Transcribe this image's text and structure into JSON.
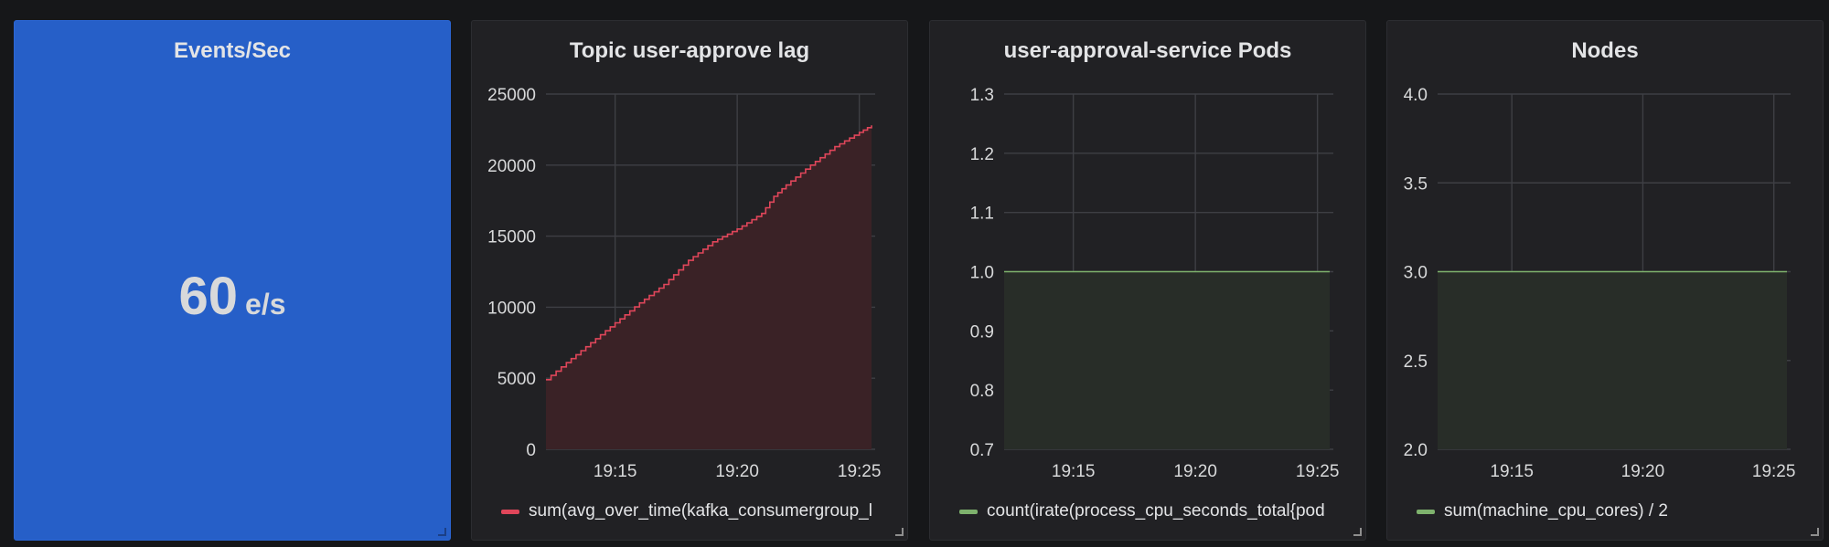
{
  "panels": {
    "events": {
      "title": "Events/Sec",
      "value": "60",
      "unit": "e/s",
      "background": "#265fc8"
    },
    "lag": {
      "title": "Topic user-approve lag"
    },
    "pods": {
      "title": "user-approval-service Pods"
    },
    "nodes": {
      "title": "Nodes"
    }
  },
  "chart_data": [
    {
      "type": "area",
      "title": "Topic user-approve lag",
      "x_ticks": [
        "19:15",
        "19:20",
        "19:25"
      ],
      "y_ticks": [
        "0",
        "5000",
        "10000",
        "15000",
        "20000",
        "25000"
      ],
      "ylim": [
        0,
        25000
      ],
      "xlim": [
        "19:12:10",
        "19:25:30"
      ],
      "grid": true,
      "series": [
        {
          "name": "sum(avg_over_time(kafka_consumergroup_l",
          "color": "#e0465a",
          "fill": "#3a2226",
          "x": [
            "19:12:10",
            "19:13:00",
            "19:14:00",
            "19:15:00",
            "19:16:00",
            "19:17:00",
            "19:18:00",
            "19:19:00",
            "19:20:00",
            "19:21:00",
            "19:21:30",
            "19:22:00",
            "19:23:00",
            "19:24:00",
            "19:25:00",
            "19:25:30"
          ],
          "values": [
            4900,
            6100,
            7500,
            8900,
            10300,
            11600,
            13300,
            14600,
            15500,
            16600,
            17800,
            18600,
            20000,
            21300,
            22300,
            22800
          ]
        }
      ]
    },
    {
      "type": "area",
      "title": "user-approval-service Pods",
      "x_ticks": [
        "19:15",
        "19:20",
        "19:25"
      ],
      "y_ticks": [
        "0.7",
        "0.8",
        "0.9",
        "1.0",
        "1.1",
        "1.2",
        "1.3"
      ],
      "ylim": [
        0.7,
        1.3
      ],
      "xlim": [
        "19:12:10",
        "19:25:30"
      ],
      "grid": true,
      "series": [
        {
          "name": "count(irate(process_cpu_seconds_total{pod",
          "color": "#7eb26d",
          "fill": "#282d28",
          "x": [
            "19:12:10",
            "19:25:30"
          ],
          "values": [
            1.0,
            1.0
          ]
        }
      ]
    },
    {
      "type": "area",
      "title": "Nodes",
      "x_ticks": [
        "19:15",
        "19:20",
        "19:25"
      ],
      "y_ticks": [
        "2.0",
        "2.5",
        "3.0",
        "3.5",
        "4.0"
      ],
      "ylim": [
        2.0,
        4.0
      ],
      "xlim": [
        "19:12:10",
        "19:25:30"
      ],
      "grid": true,
      "series": [
        {
          "name": "sum(machine_cpu_cores) / 2",
          "color": "#7eb26d",
          "fill": "#282d28",
          "x": [
            "19:12:10",
            "19:25:30"
          ],
          "values": [
            3.0,
            3.0
          ]
        }
      ]
    }
  ]
}
